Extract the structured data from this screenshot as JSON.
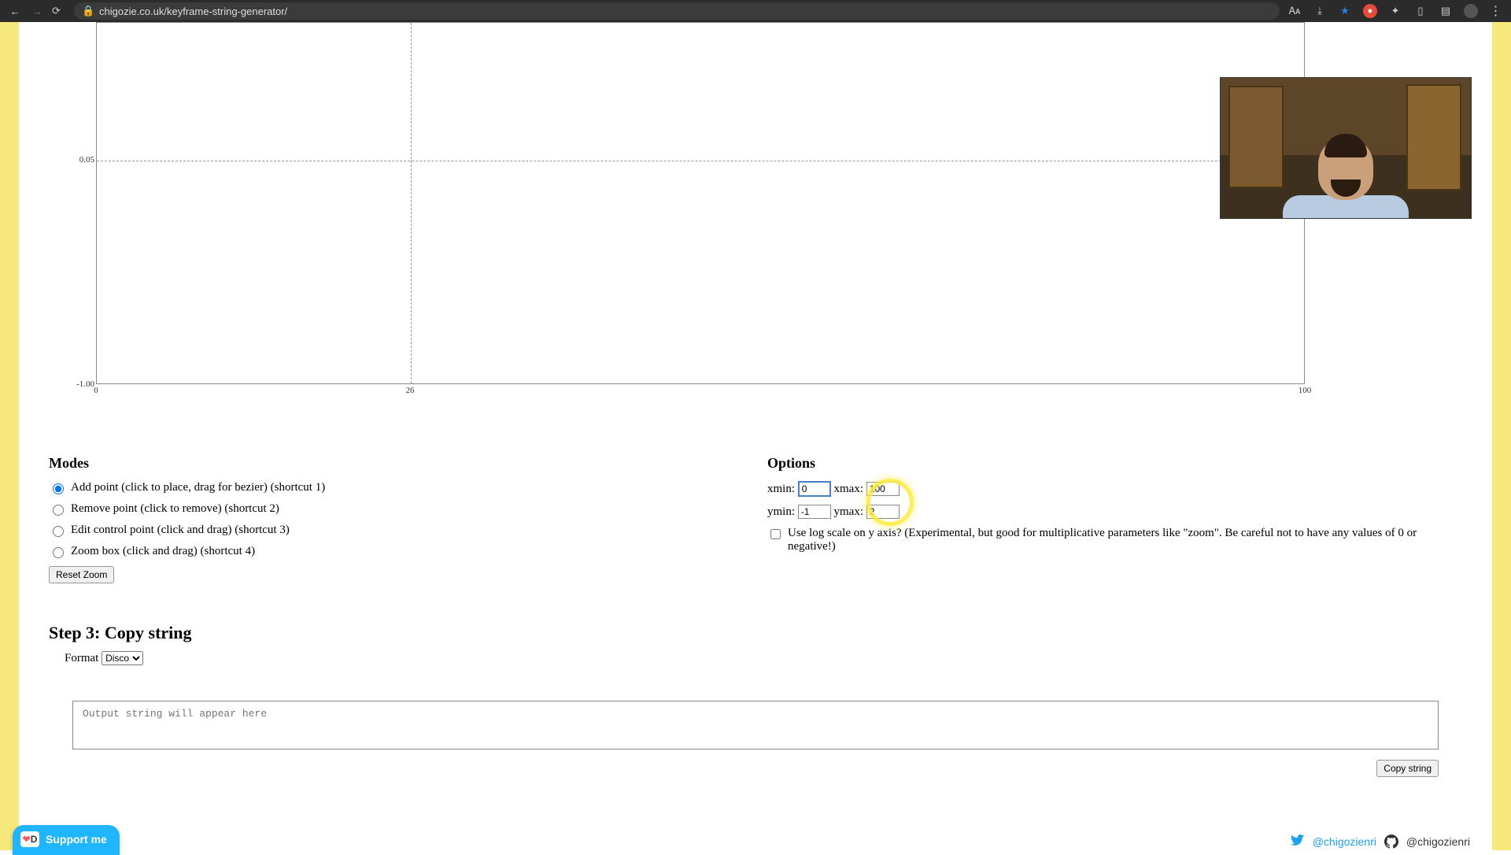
{
  "browser": {
    "url": "chigozie.co.uk/keyframe-string-generator/"
  },
  "chart_data": {
    "type": "line",
    "x": [],
    "y": [],
    "title": "",
    "xlabel": "",
    "ylabel": "",
    "xlim": [
      0,
      100
    ],
    "ylim": [
      -1.0,
      1.1
    ],
    "xticks": [
      0,
      26,
      100
    ],
    "yticks": [
      -1.0,
      0.05
    ],
    "grid": {
      "v": [
        26
      ],
      "h": [
        0.05
      ]
    }
  },
  "modes": {
    "heading": "Modes",
    "options": [
      {
        "id": "add",
        "label": "Add point (click to place, drag for bezier) (shortcut 1)",
        "selected": true
      },
      {
        "id": "remove",
        "label": "Remove point (click to remove) (shortcut 2)",
        "selected": false
      },
      {
        "id": "edit",
        "label": "Edit control point (click and drag) (shortcut 3)",
        "selected": false
      },
      {
        "id": "zoom",
        "label": "Zoom box (click and drag) (shortcut 4)",
        "selected": false
      }
    ],
    "reset_zoom_label": "Reset Zoom"
  },
  "options": {
    "heading": "Options",
    "xmin_label": "xmin:",
    "xmin_value": "0",
    "xmax_label": "xmax:",
    "xmax_value": "100",
    "ymin_label": "ymin:",
    "ymin_value": "-1",
    "ymax_label": "ymax:",
    "ymax_value": "2",
    "logscale_label": "Use log scale on y axis? (Experimental, but good for multiplicative parameters like \"zoom\". Be careful not to have any values of 0 or negative!)",
    "logscale_checked": false
  },
  "step3": {
    "heading": "Step 3: Copy string",
    "format_label": "Format",
    "format_selected": "Disco",
    "output_placeholder": "Output string will appear here",
    "copy_label": "Copy string"
  },
  "support": {
    "label": "Support me"
  },
  "social": {
    "twitter_handle": "@chigozienri",
    "github_handle": "@chigozienri"
  }
}
